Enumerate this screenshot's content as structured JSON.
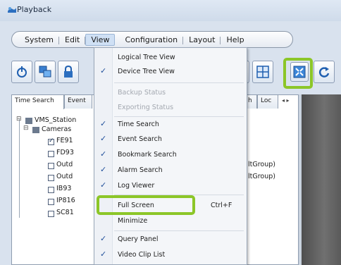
{
  "window": {
    "title": "Playback"
  },
  "menubar": {
    "items": [
      {
        "label": "System"
      },
      {
        "label": "Edit"
      },
      {
        "label": "View"
      },
      {
        "label": "Configuration"
      },
      {
        "label": "Layout"
      },
      {
        "label": "Help"
      }
    ]
  },
  "toolbar": {
    "buttons": [
      {
        "icon": "power-icon"
      },
      {
        "icon": "windows-icon"
      },
      {
        "icon": "lock-icon"
      },
      {
        "icon": "record-icon"
      },
      {
        "icon": "grid-layout-icon"
      },
      {
        "icon": "fullscreen-icon",
        "highlighted": true
      },
      {
        "icon": "refresh-icon"
      }
    ]
  },
  "tabs": {
    "items": [
      {
        "label": "Time Search"
      },
      {
        "label": "Event"
      },
      {
        "label": "h"
      },
      {
        "label": "Loc"
      }
    ]
  },
  "tree": {
    "root": "VMS_Station",
    "group": "Cameras",
    "cameras": [
      {
        "label": "FE91",
        "checked": true
      },
      {
        "label": "FD93",
        "checked": false
      },
      {
        "label": "Outd",
        "checked": false,
        "suffix": "ltGroup)"
      },
      {
        "label": "Outd",
        "checked": false,
        "suffix": "ltGroup)"
      },
      {
        "label": "IB93",
        "checked": false
      },
      {
        "label": "IP816",
        "checked": false
      },
      {
        "label": "SC81",
        "checked": false
      }
    ]
  },
  "view_menu": {
    "items": [
      {
        "label": "Logical Tree View",
        "checked": false,
        "enabled": true
      },
      {
        "label": "Device Tree View",
        "checked": true,
        "enabled": true
      },
      {
        "label": "Backup Status",
        "checked": false,
        "enabled": false
      },
      {
        "label": "Exporting Status",
        "checked": false,
        "enabled": false
      },
      {
        "label": "Time Search",
        "checked": true,
        "enabled": true
      },
      {
        "label": "Event Search",
        "checked": true,
        "enabled": true
      },
      {
        "label": "Bookmark Search",
        "checked": true,
        "enabled": true
      },
      {
        "label": "Alarm Search",
        "checked": true,
        "enabled": true
      },
      {
        "label": "Log Viewer",
        "checked": true,
        "enabled": true
      },
      {
        "label": "Full Screen",
        "checked": false,
        "enabled": true,
        "shortcut": "Ctrl+F",
        "highlighted": true
      },
      {
        "label": "Minimize",
        "checked": false,
        "enabled": true
      },
      {
        "label": "Query Panel",
        "checked": true,
        "enabled": true
      },
      {
        "label": "Video Clip List",
        "checked": true,
        "enabled": true
      }
    ]
  },
  "colors": {
    "highlight": "#8cc628",
    "accent": "#1f4e9a"
  }
}
